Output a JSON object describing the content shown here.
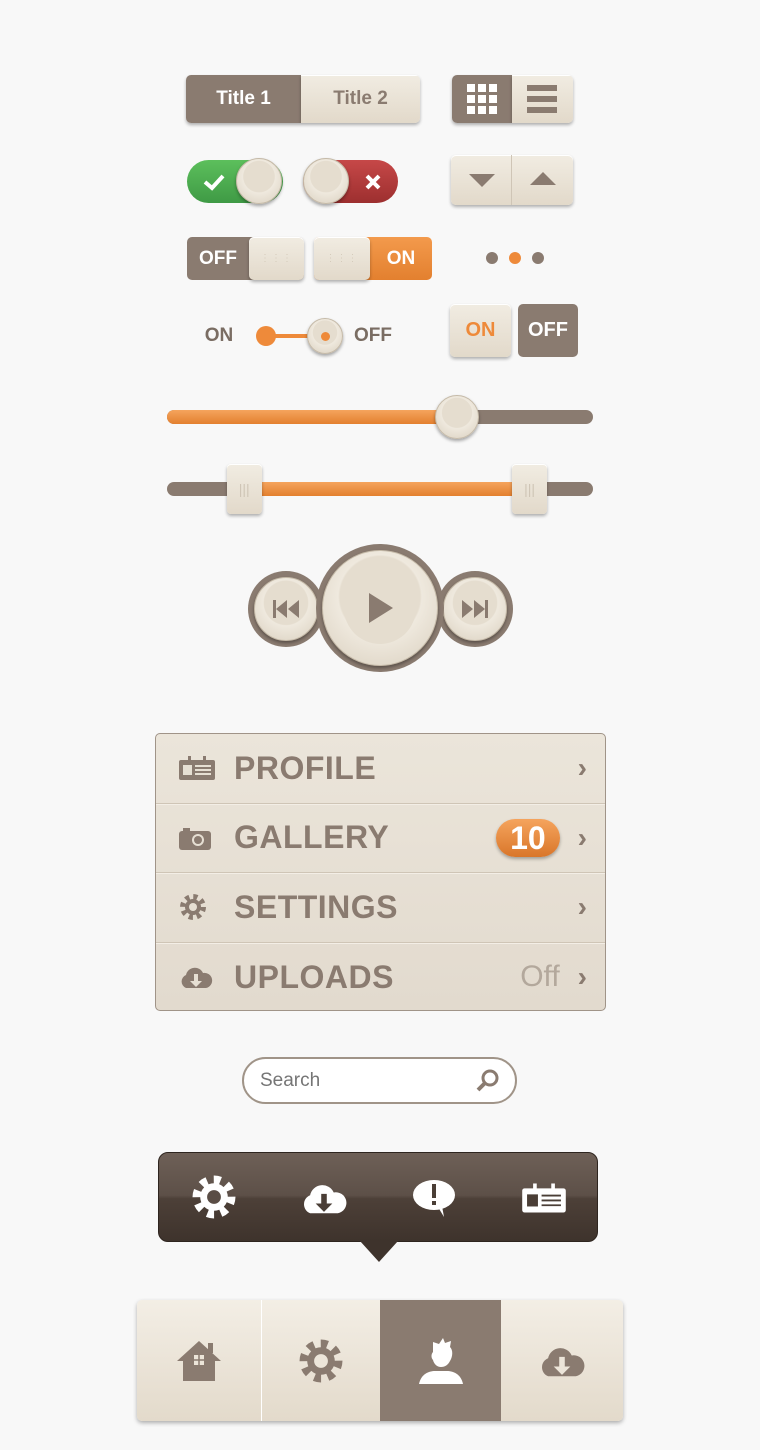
{
  "segmented": {
    "tabs": [
      {
        "label": "Title 1",
        "active": true
      },
      {
        "label": "Title 2",
        "active": false
      }
    ]
  },
  "view_toggle": {
    "options": [
      "grid-icon",
      "list-icon"
    ],
    "selected": "grid"
  },
  "check_toggle": {
    "state": "on",
    "icon": "check-icon",
    "color": "#4caf50"
  },
  "cross_toggle": {
    "state": "off",
    "icon": "close-icon",
    "color": "#b53a3a"
  },
  "arrows": {
    "down": "chevron-down-icon",
    "up": "chevron-up-icon"
  },
  "off_switch": {
    "label": "OFF"
  },
  "on_switch": {
    "label": "ON"
  },
  "page_dots": {
    "count": 3,
    "active_index": 1
  },
  "mini_switch": {
    "on_label": "ON",
    "off_label": "OFF",
    "value": "off"
  },
  "on_off_buttons": {
    "on": "ON",
    "off": "OFF",
    "selected": "off"
  },
  "slider": {
    "value_pct": 68
  },
  "range_slider": {
    "low_pct": 18,
    "high_pct": 85
  },
  "media": {
    "prev": "previous-icon",
    "play": "play-icon",
    "next": "next-icon"
  },
  "menu": {
    "items": [
      {
        "label": "PROFILE",
        "icon": "id-card-icon"
      },
      {
        "label": "GALLERY",
        "icon": "camera-icon",
        "badge": "10"
      },
      {
        "label": "SETTINGS",
        "icon": "gear-icon"
      },
      {
        "label": "UPLOADS",
        "icon": "cloud-download-icon",
        "value": "Off"
      }
    ]
  },
  "search": {
    "placeholder": "Search"
  },
  "popover": {
    "icons": [
      "gear-icon",
      "cloud-download-icon",
      "alert-bubble-icon",
      "id-card-icon"
    ]
  },
  "tabbar": {
    "tabs": [
      "home-icon",
      "gear-icon",
      "user-icon",
      "cloud-download-icon"
    ],
    "active_index": 2
  },
  "colors": {
    "brown": "#8a7b70",
    "cream": "#e9e2d6",
    "orange": "#ee8a3a",
    "dark": "#4a3e36"
  }
}
